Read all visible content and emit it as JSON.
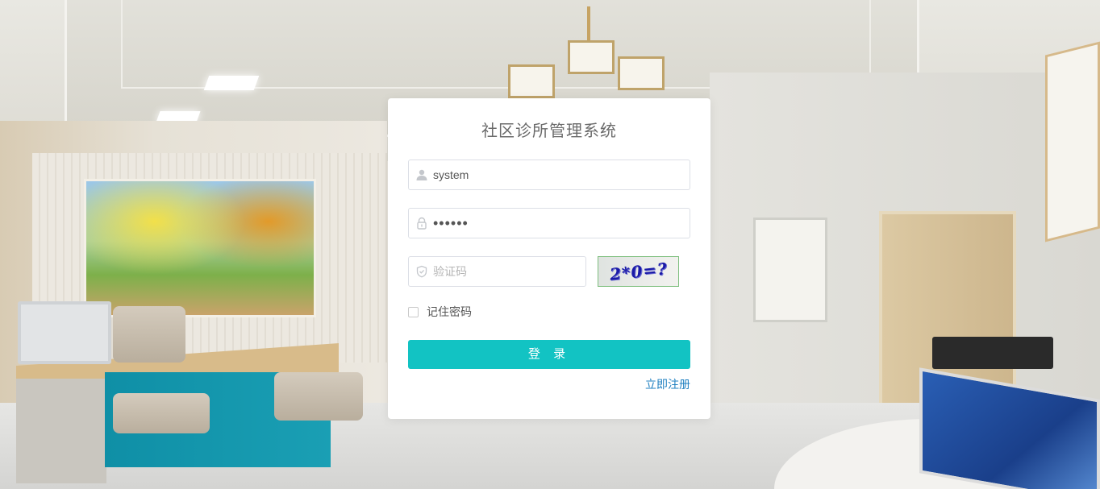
{
  "login": {
    "title": "社区诊所管理系统",
    "username": {
      "value": "system",
      "icon": "user-icon"
    },
    "password": {
      "value": "123456",
      "icon": "lock-icon"
    },
    "captcha": {
      "placeholder": "验证码",
      "value": "",
      "icon": "shield-icon",
      "image_text": "2*0=?"
    },
    "remember_label": "记住密码",
    "remember_checked": false,
    "submit_label": "登 录",
    "register_label": "立即注册"
  },
  "colors": {
    "accent": "#12c3c3",
    "link": "#1e7fc0",
    "card": "#ffffff"
  }
}
